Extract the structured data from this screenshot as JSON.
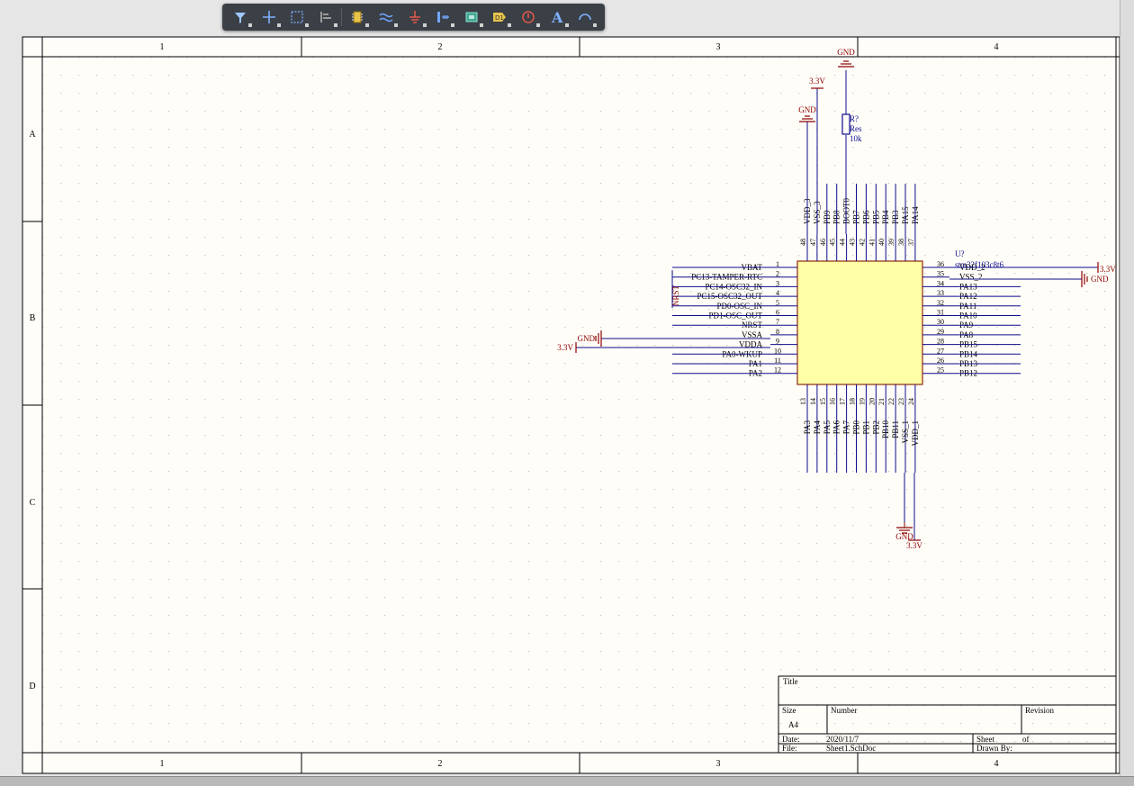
{
  "toolbar": {
    "tools": [
      {
        "name": "filter-tool-icon"
      },
      {
        "name": "move-cross-tool-icon"
      },
      {
        "name": "select-area-tool-icon"
      },
      {
        "name": "align-tool-icon"
      },
      {
        "name": "place-part-tool-icon"
      },
      {
        "name": "place-wire-tool-icon"
      },
      {
        "name": "place-power-port-tool-icon"
      },
      {
        "name": "place-bus-tool-icon"
      },
      {
        "name": "place-sheet-symbol-tool-icon"
      },
      {
        "name": "place-net-label-tool-icon"
      },
      {
        "name": "place-no-erc-tool-icon"
      },
      {
        "name": "place-text-tool-icon"
      },
      {
        "name": "place-arc-tool-icon"
      }
    ]
  },
  "frame": {
    "columns": [
      "1",
      "2",
      "3",
      "4"
    ],
    "rows": [
      "A",
      "B",
      "C",
      "D"
    ]
  },
  "colors": {
    "sheet_bg": "#fffdf8",
    "wire": "#0d0d8c",
    "power": "#8b0000",
    "body_fill": "#ffffa8",
    "body_border": "#8b2a0a",
    "pin": "#0d0d8c"
  },
  "component": {
    "designator": "U?",
    "comment": "stm32f103c8t6",
    "left_pins": [
      {
        "num": "1",
        "name": "VBAT"
      },
      {
        "num": "2",
        "name": "PC13-TAMPER-RTC"
      },
      {
        "num": "3",
        "name": "PC14-OSC32_IN"
      },
      {
        "num": "4",
        "name": "PC15-OSC32_OUT"
      },
      {
        "num": "5",
        "name": "PD0-OSC_IN"
      },
      {
        "num": "6",
        "name": "PD1-OSC_OUT"
      },
      {
        "num": "7",
        "name": "NRST"
      },
      {
        "num": "8",
        "name": "VSSA"
      },
      {
        "num": "9",
        "name": "VDDA"
      },
      {
        "num": "10",
        "name": "PA0-WKUP"
      },
      {
        "num": "11",
        "name": "PA1"
      },
      {
        "num": "12",
        "name": "PA2"
      }
    ],
    "right_pins": [
      {
        "num": "36",
        "name": "VDD_2"
      },
      {
        "num": "35",
        "name": "VSS_2"
      },
      {
        "num": "34",
        "name": "PA13"
      },
      {
        "num": "33",
        "name": "PA12"
      },
      {
        "num": "32",
        "name": "PA11"
      },
      {
        "num": "31",
        "name": "PA10"
      },
      {
        "num": "30",
        "name": "PA9"
      },
      {
        "num": "29",
        "name": "PA8"
      },
      {
        "num": "28",
        "name": "PB15"
      },
      {
        "num": "27",
        "name": "PB14"
      },
      {
        "num": "26",
        "name": "PB13"
      },
      {
        "num": "25",
        "name": "PB12"
      }
    ],
    "top_pins": [
      {
        "num": "48",
        "name": "VDD_3"
      },
      {
        "num": "47",
        "name": "VSS_3"
      },
      {
        "num": "46",
        "name": "PB9"
      },
      {
        "num": "45",
        "name": "PB8"
      },
      {
        "num": "44",
        "name": "BOOT0"
      },
      {
        "num": "43",
        "name": "PB7"
      },
      {
        "num": "42",
        "name": "PB6"
      },
      {
        "num": "41",
        "name": "PB5"
      },
      {
        "num": "40",
        "name": "PB4"
      },
      {
        "num": "39",
        "name": "PB3"
      },
      {
        "num": "38",
        "name": "PA15"
      },
      {
        "num": "37",
        "name": "PA14"
      }
    ],
    "bottom_pins": [
      {
        "num": "13",
        "name": "PA3"
      },
      {
        "num": "14",
        "name": "PA4"
      },
      {
        "num": "15",
        "name": "PA5"
      },
      {
        "num": "16",
        "name": "PA6"
      },
      {
        "num": "17",
        "name": "PA7"
      },
      {
        "num": "18",
        "name": "PB0"
      },
      {
        "num": "19",
        "name": "PB1"
      },
      {
        "num": "20",
        "name": "PB2"
      },
      {
        "num": "21",
        "name": "PB10"
      },
      {
        "num": "22",
        "name": "PB11"
      },
      {
        "num": "23",
        "name": "VSS_1"
      },
      {
        "num": "24",
        "name": "VDD_1"
      }
    ]
  },
  "resistor": {
    "designator": "R?",
    "comment": "Res",
    "value": "10k"
  },
  "power_labels": {
    "gnd": "GND",
    "v33": "3.3V",
    "net_label": "NRST"
  },
  "title_block": {
    "title_label": "Title",
    "size_label": "Size",
    "size_value": "A4",
    "number_label": "Number",
    "revision_label": "Revision",
    "date_label": "Date:",
    "date_value": "2020/11/7",
    "sheet_label": "Sheet",
    "of_label": "of",
    "file_label": "File:",
    "file_value": "Sheet1.SchDoc",
    "drawn_by_label": "Drawn By:"
  }
}
